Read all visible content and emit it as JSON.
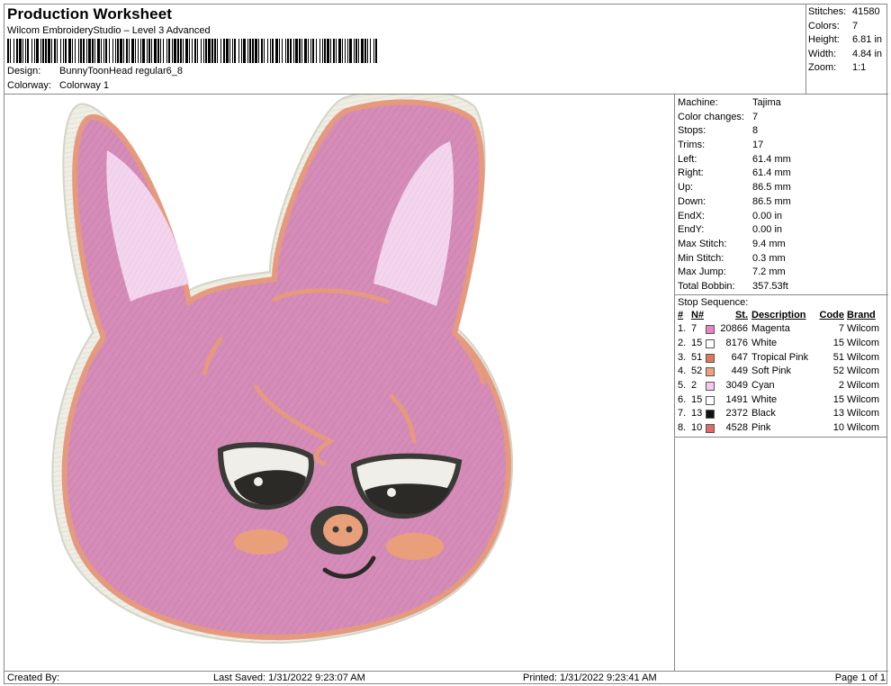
{
  "header": {
    "title": "Production Worksheet",
    "software": "Wilcom EmbroideryStudio – Level 3 Advanced",
    "design_label": "Design:",
    "design_value": "BunnyToonHead regular6_8",
    "colorway_label": "Colorway:",
    "colorway_value": "Colorway 1"
  },
  "summary": {
    "stitches_label": "Stitches:",
    "stitches_value": "41580",
    "colors_label": "Colors:",
    "colors_value": "7",
    "height_label": "Height:",
    "height_value": "6.81 in",
    "width_label": "Width:",
    "width_value": "4.84 in",
    "zoom_label": "Zoom:",
    "zoom_value": "1:1"
  },
  "machine_info": [
    {
      "label": "Machine:",
      "value": "Tajima"
    },
    {
      "label": "Color changes:",
      "value": "7"
    },
    {
      "label": "Stops:",
      "value": "8"
    },
    {
      "label": "Trims:",
      "value": "17"
    },
    {
      "label": "Left:",
      "value": "61.4 mm"
    },
    {
      "label": "Right:",
      "value": "61.4 mm"
    },
    {
      "label": "Up:",
      "value": "86.5 mm"
    },
    {
      "label": "Down:",
      "value": "86.5 mm"
    },
    {
      "label": "EndX:",
      "value": "0.00 in"
    },
    {
      "label": "EndY:",
      "value": "0.00 in"
    },
    {
      "label": "Max Stitch:",
      "value": "9.4 mm"
    },
    {
      "label": "Min Stitch:",
      "value": "0.3 mm"
    },
    {
      "label": "Max Jump:",
      "value": "7.2 mm"
    },
    {
      "label": "Total Bobbin:",
      "value": "357.53ft"
    }
  ],
  "stop_sequence": {
    "title": "Stop Sequence:",
    "columns": {
      "idx": "#",
      "needle": "N#",
      "stitches": "St.",
      "description": "Description",
      "code": "Code",
      "brand": "Brand"
    },
    "rows": [
      {
        "idx": "1.",
        "needle": "7",
        "color": "#e884c4",
        "stitches": "20866",
        "description": "Magenta",
        "code": "7",
        "brand": "Wilcom"
      },
      {
        "idx": "2.",
        "needle": "15",
        "color": "#ffffff",
        "stitches": "8176",
        "description": "White",
        "code": "15",
        "brand": "Wilcom"
      },
      {
        "idx": "3.",
        "needle": "51",
        "color": "#e07858",
        "stitches": "647",
        "description": "Tropical Pink",
        "code": "51",
        "brand": "Wilcom"
      },
      {
        "idx": "4.",
        "needle": "52",
        "color": "#f0a080",
        "stitches": "449",
        "description": "Soft Pink",
        "code": "52",
        "brand": "Wilcom"
      },
      {
        "idx": "5.",
        "needle": "2",
        "color": "#f4c8f4",
        "stitches": "3049",
        "description": "Cyan",
        "code": "2",
        "brand": "Wilcom"
      },
      {
        "idx": "6.",
        "needle": "15",
        "color": "#ffffff",
        "stitches": "1491",
        "description": "White",
        "code": "15",
        "brand": "Wilcom"
      },
      {
        "idx": "7.",
        "needle": "13",
        "color": "#111111",
        "stitches": "2372",
        "description": "Black",
        "code": "13",
        "brand": "Wilcom"
      },
      {
        "idx": "8.",
        "needle": "10",
        "color": "#e06a66",
        "stitches": "4528",
        "description": "Pink",
        "code": "10",
        "brand": "Wilcom"
      }
    ]
  },
  "footer": {
    "created_by": "Created By:",
    "last_saved": "Last Saved: 1/31/2022 9:23:07 AM",
    "printed": "Printed: 1/31/2022 9:23:41 AM",
    "page": "Page 1 of 1"
  }
}
